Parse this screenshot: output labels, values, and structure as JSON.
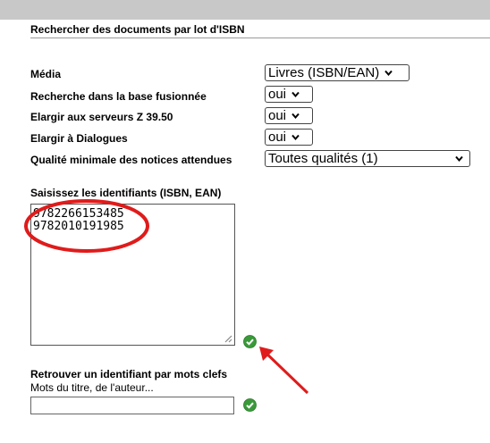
{
  "page": {
    "title": "Rechercher des documents par lot d'ISBN"
  },
  "form": {
    "media": {
      "label": "Média",
      "value": "Livres (ISBN/EAN)"
    },
    "merged_base": {
      "label": "Recherche dans la base fusionnée",
      "value": "oui"
    },
    "z3950": {
      "label": "Elargir aux serveurs Z 39.50",
      "value": "oui"
    },
    "dialogues": {
      "label": "Elargir à Dialogues",
      "value": "oui"
    },
    "quality": {
      "label": "Qualité minimale des notices attendues",
      "value": "Toutes qualités (1)"
    }
  },
  "identifiers": {
    "label": "Saisissez les identifiants (ISBN, EAN)",
    "values": [
      "9782266153485",
      "9782010191985"
    ]
  },
  "keyword_search": {
    "title": "Retrouver un identifiant par mots clefs",
    "subtitle": "Mots du titre, de l'auteur...",
    "value": ""
  },
  "icons": {
    "submit": "check-circle-icon",
    "annotation_oval": "red-oval",
    "annotation_arrow": "red-arrow"
  },
  "colors": {
    "accent_green": "#3a9a3a",
    "annotation_red": "#e01b1b",
    "topbar": "#c8c8c8"
  }
}
